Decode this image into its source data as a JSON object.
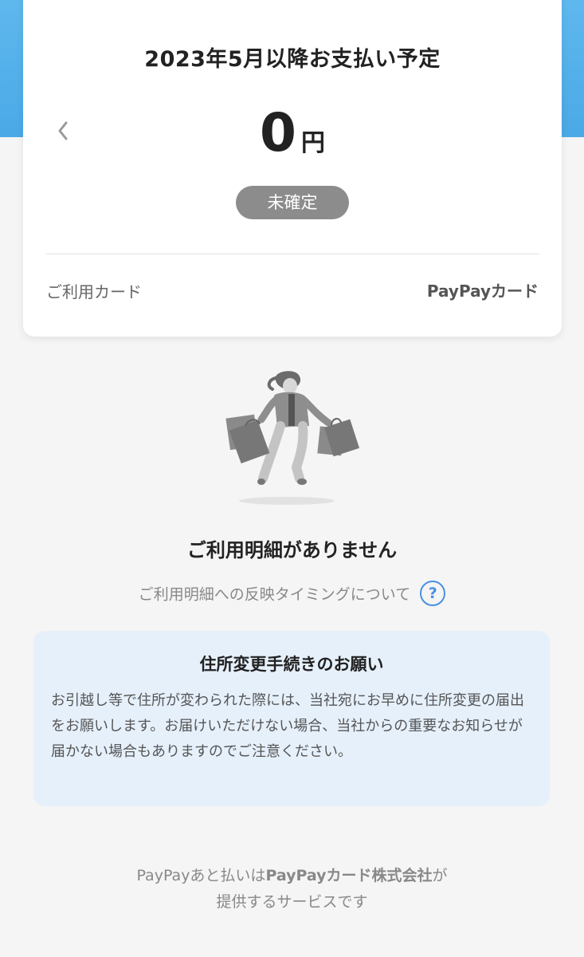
{
  "card": {
    "title": "2023年5月以降お支払い予定",
    "amount": "0",
    "amount_unit": "円",
    "status_badge": "未確定",
    "card_label": "ご利用カード",
    "card_value": "PayPayカード"
  },
  "empty_state": {
    "title": "ご利用明細がありません",
    "timing_link": "ご利用明細への反映タイミングについて",
    "help_icon_glyph": "?"
  },
  "notice": {
    "title": "住所変更手続きのお願い",
    "body": "お引越し等で住所が変わられた際には、当社宛にお早めに住所変更の届出をお願いします。お届けいただけない場合、当社からの重要なお知らせが届かない場合もありますのでご注意ください。"
  },
  "footer": {
    "prefix": "PayPayあと払いは",
    "company": "PayPayカード株式会社",
    "suffix": "が",
    "line2": "提供するサービスです"
  },
  "colors": {
    "header_blue": "#5fb8ee",
    "badge_gray": "#8c8c8c",
    "link_blue": "#4a90e2",
    "notice_bg": "#e6f0fb"
  },
  "icons": {
    "prev": "chevron-left-icon",
    "help": "question-circle-icon"
  }
}
